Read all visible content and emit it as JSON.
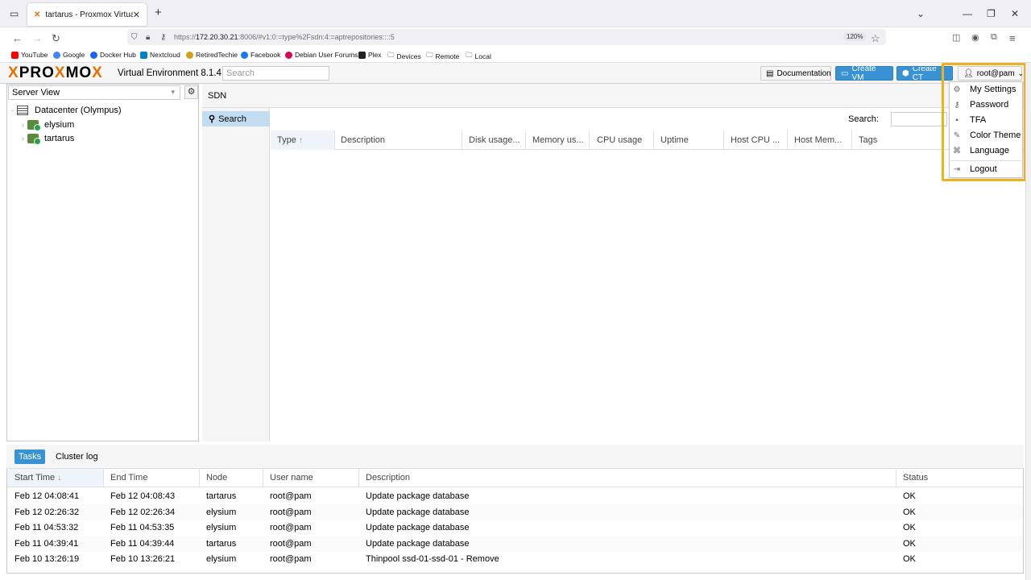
{
  "browser": {
    "tab_title": "tartarus - Proxmox Virtual Envir",
    "url_prefix": "https://",
    "url_host": "172.20.30.21",
    "url_rest": ":8006/#v1:0:=type%2Fsdn:4:=aptrepositories::::5",
    "zoom": "120%",
    "bookmarks": [
      {
        "label": "YouTube",
        "color": "#ff0000"
      },
      {
        "label": "Google",
        "color": "#4285f4"
      },
      {
        "label": "Docker Hub",
        "color": "#1d63ed"
      },
      {
        "label": "Nextcloud",
        "color": "#0082c9"
      },
      {
        "label": "RetiredTechie",
        "color": "#d4a017"
      },
      {
        "label": "Facebook",
        "color": "#1877f2"
      },
      {
        "label": "Debian User Forums",
        "color": "#d70751"
      },
      {
        "label": "Plex",
        "color": "#222222"
      },
      {
        "label": "Devices",
        "color": "#888888"
      },
      {
        "label": "Remote",
        "color": "#888888"
      },
      {
        "label": "Local",
        "color": "#888888"
      }
    ]
  },
  "header": {
    "logo_pre": "PRO",
    "logo_x": "X",
    "logo_post": "MO",
    "logo_x2": "X",
    "version": "Virtual Environment 8.1.4",
    "search_placeholder": "Search",
    "documentation": "Documentation",
    "create_vm": "Create VM",
    "create_ct": "Create CT",
    "user": "root@pam"
  },
  "sidebar": {
    "view": "Server View",
    "datacenter": "Datacenter (Olympus)",
    "nodes": [
      "elysium",
      "tartarus"
    ]
  },
  "content": {
    "title": "SDN",
    "subnav_search": "Search",
    "search_label": "Search:",
    "columns": [
      "Type",
      "Description",
      "Disk usage...",
      "Memory us...",
      "CPU usage",
      "Uptime",
      "Host CPU ...",
      "Host Mem...",
      "Tags"
    ]
  },
  "user_menu": {
    "items": [
      "My Settings",
      "Password",
      "TFA",
      "Color Theme",
      "Language",
      "Logout"
    ]
  },
  "tasks": {
    "tabs": [
      "Tasks",
      "Cluster log"
    ],
    "columns": [
      "Start Time",
      "End Time",
      "Node",
      "User name",
      "Description",
      "Status"
    ],
    "rows": [
      [
        "Feb 12 04:08:41",
        "Feb 12 04:08:43",
        "tartarus",
        "root@pam",
        "Update package database",
        "OK"
      ],
      [
        "Feb 12 02:26:32",
        "Feb 12 02:26:34",
        "elysium",
        "root@pam",
        "Update package database",
        "OK"
      ],
      [
        "Feb 11 04:53:32",
        "Feb 11 04:53:35",
        "elysium",
        "root@pam",
        "Update package database",
        "OK"
      ],
      [
        "Feb 11 04:39:41",
        "Feb 11 04:39:44",
        "tartarus",
        "root@pam",
        "Update package database",
        "OK"
      ],
      [
        "Feb 10 13:26:19",
        "Feb 10 13:26:21",
        "elysium",
        "root@pam",
        "Thinpool ssd-01-ssd-01 - Remove",
        "OK"
      ]
    ]
  }
}
